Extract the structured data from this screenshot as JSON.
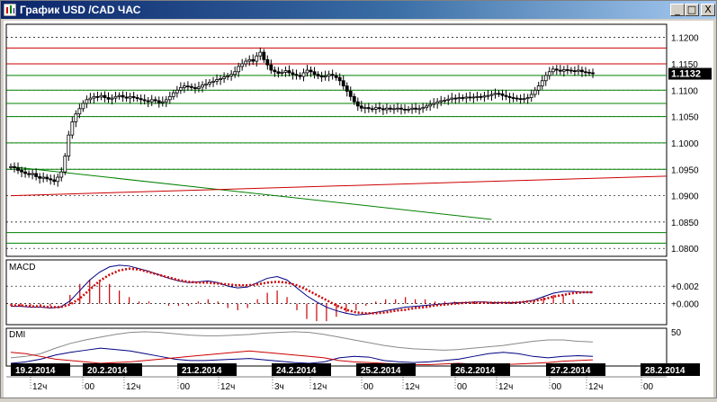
{
  "window": {
    "title": "График USD /CAD  ЧАС",
    "controls": {
      "minimize": "_",
      "maximize": "□",
      "close": "X"
    }
  },
  "colors": {
    "frame": "#d4d0c8",
    "panel_bg": "#ffffff",
    "grid": "#000000",
    "candle": "#000000",
    "resistance": "#cc0000",
    "support": "#008000",
    "macd_line": "#000080",
    "macd_signal": "#cc0000",
    "macd_hist": "#cc0000",
    "dmi_adx": "#888888",
    "dmi_plus": "#000080",
    "dmi_minus": "#cc0000",
    "date_box": "#000000",
    "date_text": "#ffffff",
    "last_price_box": "#000000",
    "last_price_text": "#ffffff"
  },
  "chart_data": [
    {
      "type": "candlestick",
      "title": "",
      "ylim": [
        1.0785,
        1.1225
      ],
      "ticks": [
        "1.1200",
        "1.1150",
        "1.1100",
        "1.1050",
        "1.1000",
        "1.0950",
        "1.0900",
        "1.0850",
        "1.0800"
      ],
      "tick_values": [
        1.12,
        1.115,
        1.11,
        1.105,
        1.1,
        1.095,
        1.09,
        1.085,
        1.08
      ],
      "last_price": "1.1132",
      "last_price_value": 1.1132,
      "horizontal_levels": [
        {
          "value": 1.118,
          "color": "red"
        },
        {
          "value": 1.115,
          "color": "red"
        },
        {
          "value": 1.1128,
          "color": "green"
        },
        {
          "value": 1.11,
          "color": "green"
        },
        {
          "value": 1.1075,
          "color": "green"
        },
        {
          "value": 1.105,
          "color": "green"
        },
        {
          "value": 1.1,
          "color": "green"
        },
        {
          "value": 1.095,
          "color": "green"
        },
        {
          "value": 1.083,
          "color": "green"
        },
        {
          "value": 1.081,
          "color": "green"
        }
      ],
      "trend_lines": [
        {
          "from": [
            0,
            1.0955
          ],
          "to": [
            133,
            1.0855
          ],
          "color": "green"
        },
        {
          "from": [
            0,
            1.09
          ],
          "to": [
            190,
            1.0937
          ],
          "color": "red"
        }
      ],
      "closes": [
        1.0955,
        1.0953,
        1.0948,
        1.0945,
        1.0942,
        1.094,
        1.0942,
        1.0936,
        1.0933,
        1.0935,
        1.0932,
        1.093,
        1.0927,
        1.0935,
        1.0945,
        1.0975,
        1.1015,
        1.104,
        1.1055,
        1.1065,
        1.1075,
        1.1082,
        1.1085,
        1.1088,
        1.1087,
        1.109,
        1.1086,
        1.1083,
        1.1085,
        1.1088,
        1.109,
        1.1087,
        1.1085,
        1.1088,
        1.1086,
        1.1084,
        1.1082,
        1.108,
        1.1078,
        1.1082,
        1.108,
        1.1076,
        1.1078,
        1.1082,
        1.1088,
        1.1095,
        1.11,
        1.1105,
        1.1108,
        1.1107,
        1.1105,
        1.1103,
        1.1106,
        1.111,
        1.1112,
        1.1115,
        1.1117,
        1.112,
        1.1122,
        1.1125,
        1.1127,
        1.113,
        1.1135,
        1.1145,
        1.115,
        1.1155,
        1.1158,
        1.1155,
        1.1165,
        1.1172,
        1.1158,
        1.1148,
        1.1138,
        1.1135,
        1.1132,
        1.1134,
        1.1137,
        1.1133,
        1.113,
        1.1128,
        1.1126,
        1.1133,
        1.1138,
        1.1135,
        1.113,
        1.1127,
        1.1125,
        1.1127,
        1.113,
        1.1128,
        1.1124,
        1.1118,
        1.1108,
        1.1098,
        1.1088,
        1.1078,
        1.107,
        1.1066,
        1.1067,
        1.1065,
        1.1064,
        1.1067,
        1.1065,
        1.1063,
        1.1066,
        1.1064,
        1.1065,
        1.1066,
        1.1064,
        1.1063,
        1.1064,
        1.1066,
        1.1064,
        1.1065,
        1.1067,
        1.107,
        1.1073,
        1.1075,
        1.1078,
        1.108,
        1.1081,
        1.1083,
        1.1085,
        1.1084,
        1.1086,
        1.1085,
        1.1087,
        1.1086,
        1.1087,
        1.1088,
        1.1087,
        1.1089,
        1.109,
        1.1092,
        1.1094,
        1.1093,
        1.109,
        1.1088,
        1.1086,
        1.1085,
        1.1084,
        1.1083,
        1.1084,
        1.1086,
        1.1092,
        1.11,
        1.1108,
        1.1118,
        1.1128,
        1.1135,
        1.114,
        1.1138,
        1.1136,
        1.1139,
        1.1138,
        1.1137,
        1.1136,
        1.1138,
        1.1135,
        1.1134,
        1.1133,
        1.1132
      ]
    },
    {
      "type": "line",
      "title": "MACD",
      "ticks": [
        "+0.002",
        "+0.000"
      ],
      "tick_values": [
        0.002,
        0.0
      ],
      "ylim": [
        -0.0024,
        0.005
      ],
      "series": [
        {
          "values": [
            -0.0003,
            -0.0003,
            -0.0004,
            -0.0004,
            -0.0005,
            -0.0004,
            0.0003,
            0.0015,
            0.0027,
            0.0036,
            0.0042,
            0.0044,
            0.0043,
            0.004,
            0.0037,
            0.0033,
            0.0029,
            0.0026,
            0.0024,
            0.0025,
            0.0026,
            0.0024,
            0.002,
            0.0018,
            0.0019,
            0.0024,
            0.0029,
            0.0031,
            0.0027,
            0.0018,
            0.0009,
            0.0002,
            -0.0004,
            -0.0008,
            -0.0011,
            -0.0013,
            -0.0012,
            -0.001,
            -0.0008,
            -0.0006,
            -0.0004,
            -0.0003,
            -0.0002,
            -0.0001,
            0.0,
            0.0001,
            0.0001,
            0.0002,
            0.0002,
            0.0001,
            0.0001,
            0.0001,
            0.0002,
            0.0004,
            0.0008,
            0.0012,
            0.0014,
            0.0014,
            0.0013,
            0.0013
          ]
        },
        {
          "values": [
            -0.0002,
            -0.0002,
            -0.0003,
            -0.0003,
            -0.0004,
            -0.0004,
            -0.0001,
            0.0006,
            0.0016,
            0.0026,
            0.0033,
            0.0038,
            0.004,
            0.0039,
            0.0036,
            0.0033,
            0.003,
            0.0027,
            0.0025,
            0.0024,
            0.0024,
            0.0023,
            0.0022,
            0.0021,
            0.0021,
            0.0022,
            0.0024,
            0.0025,
            0.0024,
            0.0021,
            0.0016,
            0.001,
            0.0004,
            -0.0002,
            -0.0007,
            -0.001,
            -0.0011,
            -0.0011,
            -0.001,
            -0.0008,
            -0.0007,
            -0.0005,
            -0.0004,
            -0.0002,
            -0.0001,
            0.0,
            0.0001,
            0.0001,
            0.0001,
            0.0001,
            0.0001,
            0.0001,
            0.0002,
            0.0003,
            0.0005,
            0.0008,
            0.001,
            0.0012,
            0.0013,
            0.0013
          ]
        }
      ]
    },
    {
      "type": "line",
      "title": "DMI",
      "ticks": [
        "50"
      ],
      "tick_values": [
        50
      ],
      "ylim": [
        0,
        55
      ],
      "series": [
        {
          "values": [
            12,
            14,
            18,
            26,
            33,
            38,
            42,
            46,
            49,
            50,
            49,
            47,
            45,
            44,
            44,
            45,
            46,
            48,
            49,
            50,
            49,
            46,
            42,
            38,
            34,
            30,
            27,
            25,
            24,
            23,
            24,
            26,
            28,
            30,
            33,
            36,
            38,
            38,
            36,
            35
          ]
        },
        {
          "values": [
            4,
            6,
            10,
            16,
            20,
            23,
            26,
            24,
            22,
            18,
            14,
            10,
            8,
            8,
            9,
            10,
            11,
            9,
            7,
            5,
            4,
            6,
            12,
            14,
            13,
            8,
            6,
            5,
            6,
            8,
            10,
            14,
            18,
            20,
            18,
            14,
            12,
            14,
            15,
            14
          ]
        },
        {
          "values": [
            20,
            18,
            14,
            10,
            8,
            6,
            4,
            5,
            6,
            8,
            10,
            12,
            14,
            16,
            18,
            20,
            22,
            20,
            18,
            16,
            14,
            12,
            8,
            6,
            5,
            4,
            3,
            2,
            2,
            3,
            4,
            3,
            2,
            2,
            3,
            4,
            5,
            7,
            8,
            9
          ]
        }
      ]
    }
  ],
  "time_axis": {
    "dates": [
      "19.2.2014",
      "20.2.2014",
      "21.2.2014",
      "24.2.2014",
      "25.2.2014",
      "26.2.2014",
      "27.2.2014",
      "28.2.2014"
    ],
    "hours": [
      "12ч",
      "00",
      "12ч",
      "00",
      "12ч",
      "3ч",
      "12ч",
      "00",
      "12ч",
      "00",
      "12ч",
      "00",
      "12ч",
      "00"
    ]
  }
}
